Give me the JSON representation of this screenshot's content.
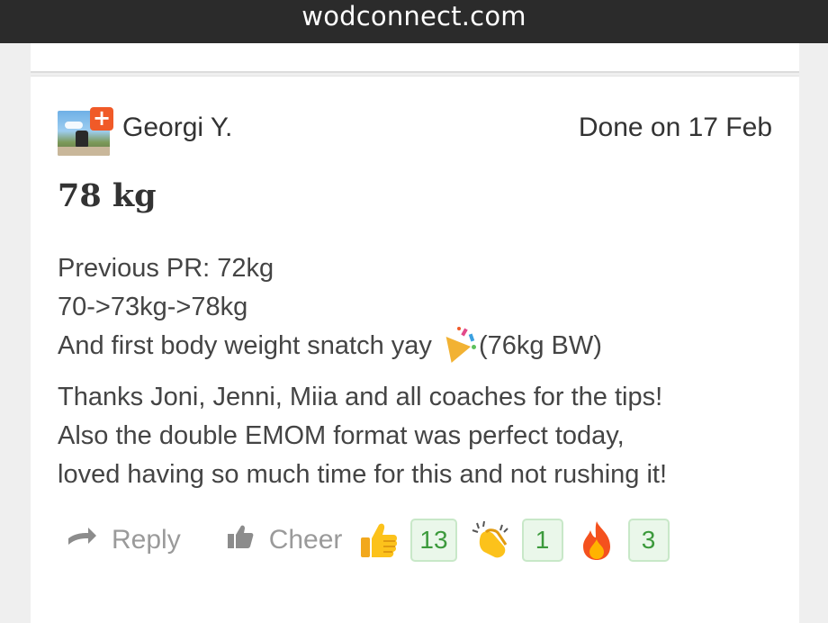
{
  "browser": {
    "url": "wodconnect.com"
  },
  "post": {
    "author": "Georgi Y.",
    "done_text": "Done on 17 Feb",
    "result": "78 kg",
    "description": {
      "line1": "Previous PR: 72kg",
      "line2": "70->73kg->78kg",
      "line3_before": "And first body weight snatch yay",
      "line3_after": "(76kg BW)",
      "line3_emoji": "party-popper-icon",
      "para2_line1": "Thanks Joni, Jenni, Miia and all coaches for the tips!",
      "para2_line2": "Also the double EMOM format was perfect today,",
      "para2_line3": "loved having so much time for this and not rushing it!"
    },
    "actions": {
      "reply_label": "Reply",
      "cheer_label": "Cheer"
    },
    "reactions": [
      {
        "emoji": "thumbs-up-icon",
        "count": "13"
      },
      {
        "emoji": "clapping-hands-icon",
        "count": "1"
      },
      {
        "emoji": "fire-icon",
        "count": "3"
      }
    ]
  },
  "colors": {
    "url_bar_bg": "#2b2b2b",
    "badge_orange": "#f05a28",
    "count_green": "#3c9a3c",
    "count_bg": "#eaf7ea",
    "muted_text": "#9a9a9a"
  }
}
